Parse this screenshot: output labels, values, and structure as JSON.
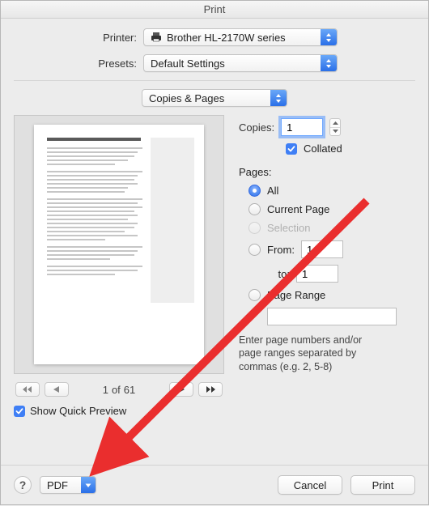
{
  "window": {
    "title": "Print"
  },
  "top": {
    "printer_label": "Printer:",
    "printer_value": "Brother HL-2170W series",
    "presets_label": "Presets:",
    "presets_value": "Default Settings",
    "section_value": "Copies & Pages"
  },
  "options": {
    "copies_label": "Copies:",
    "copies_value": "1",
    "collated_label": "Collated",
    "pages_label": "Pages:",
    "radio_all": "All",
    "radio_current": "Current Page",
    "radio_selection": "Selection",
    "radio_from": "From:",
    "from_value": "1",
    "to_label": "to:",
    "to_value": "1",
    "radio_range": "Page Range",
    "range_value": "",
    "hint": "Enter page numbers and/or page ranges separated by commas (e.g. 2, 5-8)"
  },
  "preview": {
    "page_current": "1",
    "page_of": "of",
    "page_total": "61",
    "show_quick_preview": "Show Quick Preview"
  },
  "bottom": {
    "help": "?",
    "pdf_label": "PDF",
    "cancel": "Cancel",
    "print": "Print"
  }
}
